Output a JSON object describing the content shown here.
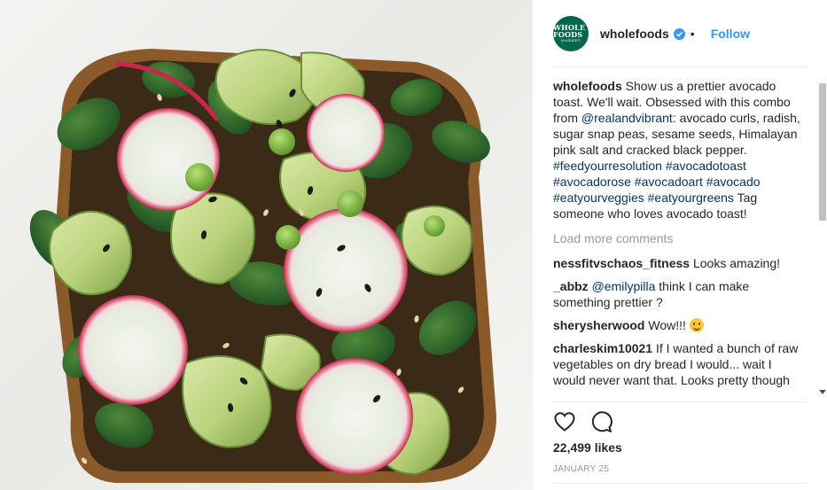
{
  "post": {
    "photo_alt": "",
    "header": {
      "avatar_text_line1": "WHOLE FOODS",
      "avatar_text_line2": "MARKET",
      "username": "wholefoods",
      "separator": "•",
      "follow_label": "Follow"
    },
    "caption": {
      "author": "wholefoods",
      "text_1": " Show us a prettier avocado toast. We'll wait. Obsessed with this combo from ",
      "mention": "@realandvibrant",
      "text_2": ": avocado curls, radish, sugar snap peas, sesame seeds, Himalayan pink salt and cracked black pepper. ",
      "hashtags": [
        "#feedyourresolution",
        "#avocadotoast",
        "#avocadorose",
        "#avocadoart",
        "#avocado",
        "#eatyourveggies",
        "#eatyourgreens"
      ],
      "text_3": " Tag someone who loves avocado toast!"
    },
    "load_more": "Load more comments",
    "comments": [
      {
        "author": "nessfitvschaos_fitness",
        "pre": " Looks amazing!",
        "mention": "",
        "post": ""
      },
      {
        "author": "_abbz",
        "pre": " ",
        "mention": "@emilypilla",
        "post": " think I can make something prettier ?"
      },
      {
        "author": "sherysherwood",
        "pre": " Wow!!! ",
        "mention": "",
        "post": ""
      },
      {
        "author": "charleskim10021",
        "pre": " If I wanted a bunch of raw vegetables on dry bread I would... wait I would never want that. Looks pretty though",
        "mention": "",
        "post": ""
      }
    ],
    "likes": "22,499 likes",
    "date": "JANUARY 25",
    "colors": {
      "link": "#003569",
      "follow": "#3897f0",
      "brand_green": "#00674b",
      "muted": "#999999"
    },
    "icons": [
      "verified-badge-icon",
      "heart-icon",
      "comment-icon",
      "smiling-emoji-icon"
    ]
  }
}
